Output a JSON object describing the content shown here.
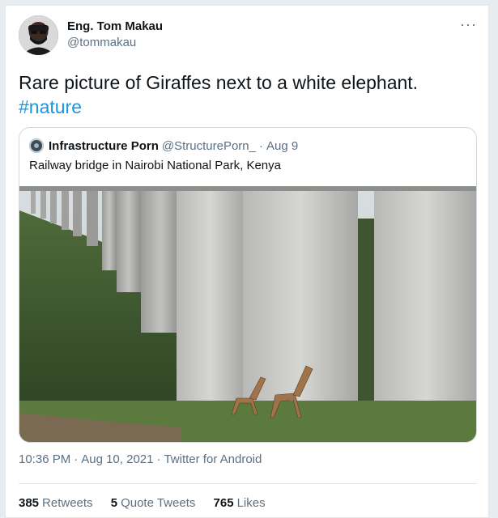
{
  "author": {
    "name": "Eng. Tom Makau",
    "handle": "@tommakau"
  },
  "more_icon": "more-horizontal-icon",
  "tweet": {
    "text": "Rare picture of Giraffes next to a white elephant.",
    "hashtag": "#nature"
  },
  "quoted": {
    "name": "Infrastructure Porn",
    "handle": "@StructurePorn_",
    "separator": "·",
    "date": "Aug 9",
    "text": "Railway bridge in Nairobi National Park, Kenya",
    "photo_description": "giraffes walking under concrete railway bridge pillars"
  },
  "meta": {
    "time": "10:36 PM",
    "separator": "·",
    "date": "Aug 10, 2021",
    "client": "Twitter for Android"
  },
  "stats": {
    "retweets_count": "385",
    "retweets_label": "Retweets",
    "quotes_count": "5",
    "quotes_label": "Quote Tweets",
    "likes_count": "765",
    "likes_label": "Likes"
  },
  "colors": {
    "link": "#1b95e0",
    "secondary_text": "#5b7083",
    "primary_text": "#0f1419"
  }
}
